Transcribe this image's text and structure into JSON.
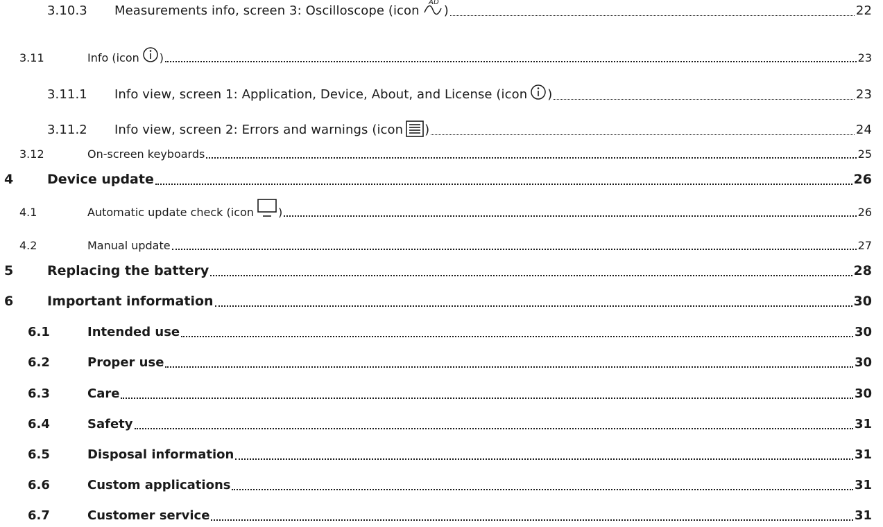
{
  "toc": {
    "entries": [
      {
        "number": "3.10.3",
        "text": "Measurements info, screen 3: Oscilloscope (icon",
        "suffix": ")",
        "page": "22",
        "icon": "oscilloscope-ad-icon"
      },
      {
        "number": "3.11",
        "text": "Info (icon",
        "suffix": ")",
        "page": "23",
        "icon": "info-circle-icon"
      },
      {
        "number": "3.11.1",
        "text": "Info view, screen 1: Application, Device, About, and License (icon",
        "suffix": ")",
        "page": "23",
        "icon": "info-circle-icon"
      },
      {
        "number": "3.11.2",
        "text": "Info view, screen 2: Errors and warnings (icon",
        "suffix": ")",
        "page": "24",
        "icon": "list-lines-icon"
      },
      {
        "number": "3.12",
        "text": "On-screen keyboards",
        "page": "25"
      },
      {
        "number": "4",
        "text": "Device update",
        "page": "26"
      },
      {
        "number": "4.1",
        "text": "Automatic update check (icon",
        "suffix": ")",
        "page": "26",
        "icon": "monitor-icon"
      },
      {
        "number": "4.2",
        "text": "Manual update",
        "page": "27"
      },
      {
        "number": "5",
        "text": "Replacing the battery",
        "page": "28"
      },
      {
        "number": "6",
        "text": "Important information",
        "page": "30"
      },
      {
        "number": "6.1",
        "text": "Intended use",
        "page": "30"
      },
      {
        "number": "6.2",
        "text": "Proper use",
        "page": "30"
      },
      {
        "number": "6.3",
        "text": "Care",
        "page": "30"
      },
      {
        "number": "6.4",
        "text": "Safety",
        "page": "31"
      },
      {
        "number": "6.5",
        "text": "Disposal information",
        "page": "31"
      },
      {
        "number": "6.6",
        "text": "Custom applications",
        "page": "31"
      },
      {
        "number": "6.7",
        "text": "Customer service",
        "page": "31"
      }
    ]
  },
  "colors": {
    "text": "#1a1a1a",
    "background": "#ffffff"
  }
}
